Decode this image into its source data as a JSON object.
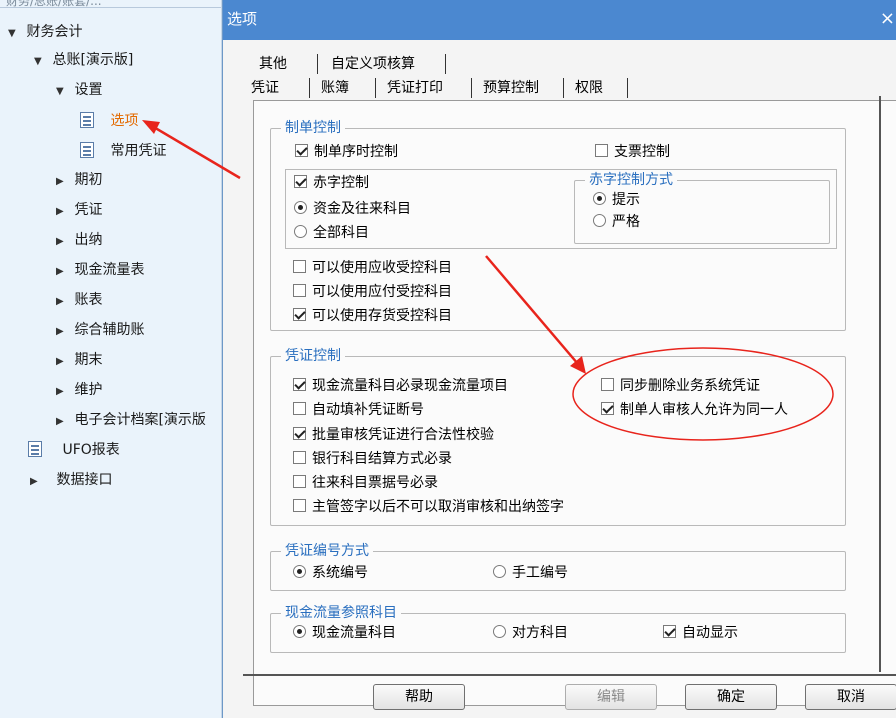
{
  "tree": {
    "top_label": "财务/总账/账套/...",
    "items": [
      {
        "label": "财务会计"
      },
      {
        "label": "总账[演示版]"
      },
      {
        "label": "设置"
      },
      {
        "label": "选项"
      },
      {
        "label": "常用凭证"
      },
      {
        "label": "期初"
      },
      {
        "label": "凭证"
      },
      {
        "label": "出纳"
      },
      {
        "label": "现金流量表"
      },
      {
        "label": "账表"
      },
      {
        "label": "综合辅助账"
      },
      {
        "label": "期末"
      },
      {
        "label": "维护"
      },
      {
        "label": "电子会计档案[演示版"
      },
      {
        "label": "UFO报表"
      },
      {
        "label": "数据接口"
      }
    ]
  },
  "dialog": {
    "title": "选项",
    "close_glyph": "×",
    "tabs_row1": [
      "其他",
      "自定义项核算"
    ],
    "tabs_row2": [
      "凭证",
      "账簿",
      "凭证打印",
      "预算控制",
      "权限"
    ],
    "groups": {
      "zhidan": {
        "title": "制单控制",
        "opt_xushi": "制单序时控制",
        "opt_zhipiao": "支票控制",
        "opt_chizi": "赤字控制",
        "opt_zijin": "资金及往来科目",
        "opt_quanbu": "全部科目",
        "chizi_mode_title": "赤字控制方式",
        "opt_tishi": "提示",
        "opt_yange": "严格",
        "opt_yingshou": "可以使用应收受控科目",
        "opt_yingfu": "可以使用应付受控科目",
        "opt_cunhuo": "可以使用存货受控科目"
      },
      "pingzheng": {
        "title": "凭证控制",
        "opt_xianjin": "现金流量科目必录现金流量项目",
        "opt_zidong": "自动填补凭证断号",
        "opt_piliang": "批量审核凭证进行合法性校验",
        "opt_yinhang": "银行科目结算方式必录",
        "opt_wanglai": "往来科目票据号必录",
        "opt_zhuguan": "主管签字以后不可以取消审核和出纳签字",
        "opt_tongbu": "同步删除业务系统凭证",
        "opt_tongyiren": "制单人审核人允许为同一人"
      },
      "bianhao": {
        "title": "凭证编号方式",
        "opt_xitong": "系统编号",
        "opt_shougong": "手工编号"
      },
      "xianjinliu": {
        "title": "现金流量参照科目",
        "opt_xjll": "现金流量科目",
        "opt_duifang": "对方科目",
        "opt_zidongxs": "自动显示"
      }
    },
    "buttons": {
      "help": "帮助",
      "edit": "编辑",
      "ok": "确定",
      "cancel": "取消"
    }
  },
  "colors": {
    "annotation_red": "#e8241c",
    "titlebar_blue": "#4b88d0",
    "group_title_blue": "#2a6fbf",
    "selected_orange": "#e36a00"
  }
}
